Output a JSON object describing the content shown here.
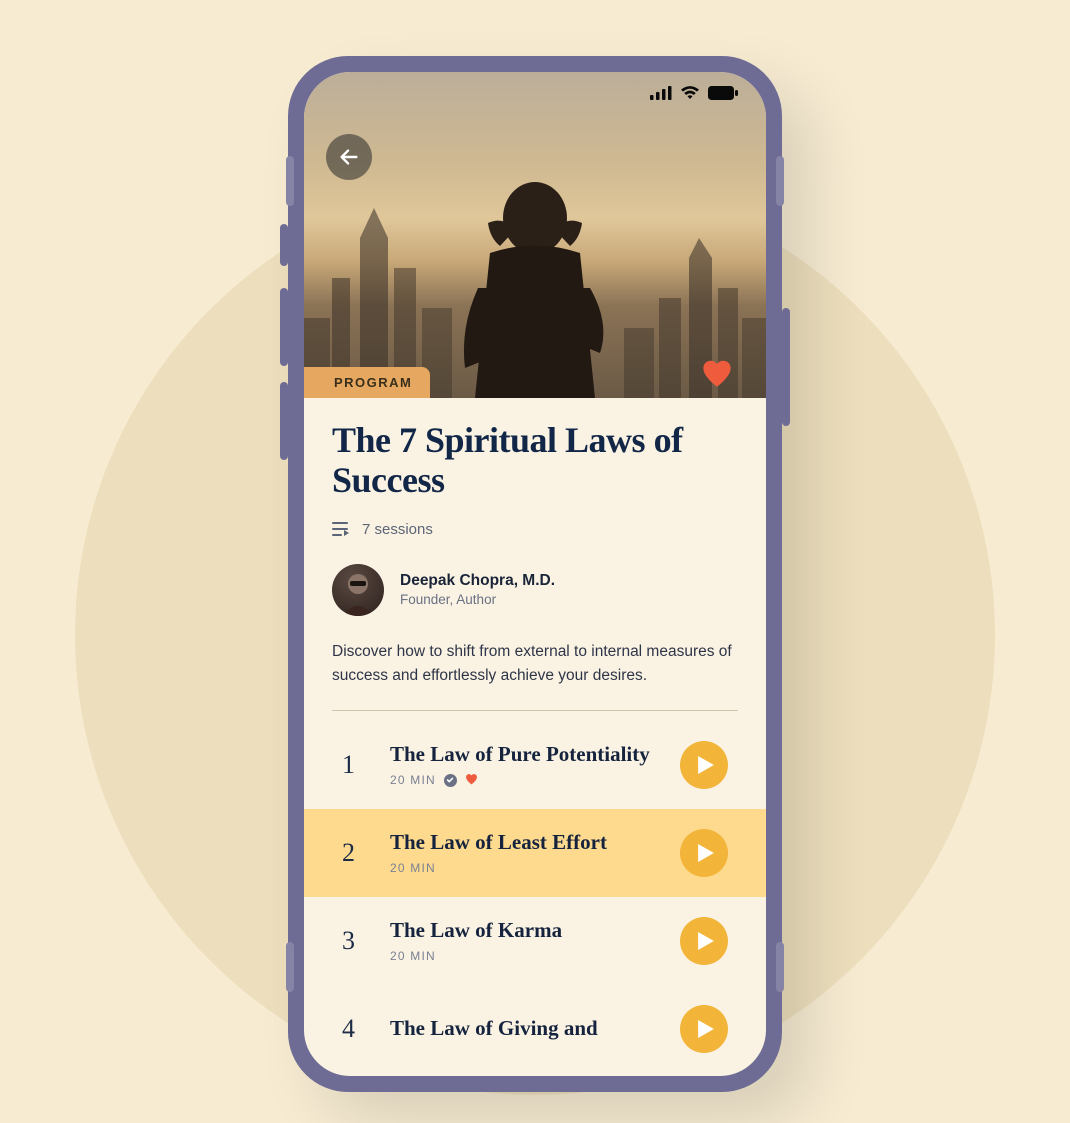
{
  "hero": {
    "tag": "PROGRAM"
  },
  "program": {
    "title": "The 7 Spiritual Laws of Success",
    "sessions_label": "7 sessions",
    "description": "Discover how to shift from external to internal measures of success and effortlessly achieve your desires."
  },
  "author": {
    "name": "Deepak Chopra, M.D.",
    "role": "Founder, Author"
  },
  "sessions": [
    {
      "num": "1",
      "title": "The Law of Pure Potentiality",
      "duration": "20 MIN",
      "completed": true,
      "favorited": true,
      "highlight": false
    },
    {
      "num": "2",
      "title": "The Law of Least Effort",
      "duration": "20 MIN",
      "completed": false,
      "favorited": false,
      "highlight": true
    },
    {
      "num": "3",
      "title": "The Law of Karma",
      "duration": "20 MIN",
      "completed": false,
      "favorited": false,
      "highlight": false
    },
    {
      "num": "4",
      "title": "The Law of Giving and",
      "duration": "",
      "completed": false,
      "favorited": false,
      "highlight": false
    }
  ],
  "colors": {
    "accent": "#f3b43a",
    "heart": "#ee5c3d",
    "frame": "#6e6c94"
  }
}
